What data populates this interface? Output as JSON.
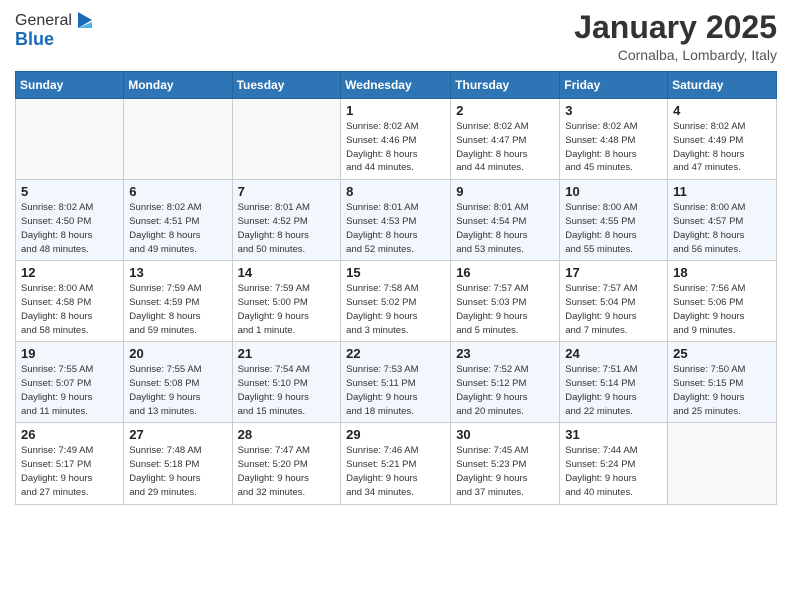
{
  "header": {
    "logo_general": "General",
    "logo_blue": "Blue",
    "month_title": "January 2025",
    "location": "Cornalba, Lombardy, Italy"
  },
  "weekdays": [
    "Sunday",
    "Monday",
    "Tuesday",
    "Wednesday",
    "Thursday",
    "Friday",
    "Saturday"
  ],
  "weeks": [
    [
      {
        "day": "",
        "info": ""
      },
      {
        "day": "",
        "info": ""
      },
      {
        "day": "",
        "info": ""
      },
      {
        "day": "1",
        "info": "Sunrise: 8:02 AM\nSunset: 4:46 PM\nDaylight: 8 hours\nand 44 minutes."
      },
      {
        "day": "2",
        "info": "Sunrise: 8:02 AM\nSunset: 4:47 PM\nDaylight: 8 hours\nand 44 minutes."
      },
      {
        "day": "3",
        "info": "Sunrise: 8:02 AM\nSunset: 4:48 PM\nDaylight: 8 hours\nand 45 minutes."
      },
      {
        "day": "4",
        "info": "Sunrise: 8:02 AM\nSunset: 4:49 PM\nDaylight: 8 hours\nand 47 minutes."
      }
    ],
    [
      {
        "day": "5",
        "info": "Sunrise: 8:02 AM\nSunset: 4:50 PM\nDaylight: 8 hours\nand 48 minutes."
      },
      {
        "day": "6",
        "info": "Sunrise: 8:02 AM\nSunset: 4:51 PM\nDaylight: 8 hours\nand 49 minutes."
      },
      {
        "day": "7",
        "info": "Sunrise: 8:01 AM\nSunset: 4:52 PM\nDaylight: 8 hours\nand 50 minutes."
      },
      {
        "day": "8",
        "info": "Sunrise: 8:01 AM\nSunset: 4:53 PM\nDaylight: 8 hours\nand 52 minutes."
      },
      {
        "day": "9",
        "info": "Sunrise: 8:01 AM\nSunset: 4:54 PM\nDaylight: 8 hours\nand 53 minutes."
      },
      {
        "day": "10",
        "info": "Sunrise: 8:00 AM\nSunset: 4:55 PM\nDaylight: 8 hours\nand 55 minutes."
      },
      {
        "day": "11",
        "info": "Sunrise: 8:00 AM\nSunset: 4:57 PM\nDaylight: 8 hours\nand 56 minutes."
      }
    ],
    [
      {
        "day": "12",
        "info": "Sunrise: 8:00 AM\nSunset: 4:58 PM\nDaylight: 8 hours\nand 58 minutes."
      },
      {
        "day": "13",
        "info": "Sunrise: 7:59 AM\nSunset: 4:59 PM\nDaylight: 8 hours\nand 59 minutes."
      },
      {
        "day": "14",
        "info": "Sunrise: 7:59 AM\nSunset: 5:00 PM\nDaylight: 9 hours\nand 1 minute."
      },
      {
        "day": "15",
        "info": "Sunrise: 7:58 AM\nSunset: 5:02 PM\nDaylight: 9 hours\nand 3 minutes."
      },
      {
        "day": "16",
        "info": "Sunrise: 7:57 AM\nSunset: 5:03 PM\nDaylight: 9 hours\nand 5 minutes."
      },
      {
        "day": "17",
        "info": "Sunrise: 7:57 AM\nSunset: 5:04 PM\nDaylight: 9 hours\nand 7 minutes."
      },
      {
        "day": "18",
        "info": "Sunrise: 7:56 AM\nSunset: 5:06 PM\nDaylight: 9 hours\nand 9 minutes."
      }
    ],
    [
      {
        "day": "19",
        "info": "Sunrise: 7:55 AM\nSunset: 5:07 PM\nDaylight: 9 hours\nand 11 minutes."
      },
      {
        "day": "20",
        "info": "Sunrise: 7:55 AM\nSunset: 5:08 PM\nDaylight: 9 hours\nand 13 minutes."
      },
      {
        "day": "21",
        "info": "Sunrise: 7:54 AM\nSunset: 5:10 PM\nDaylight: 9 hours\nand 15 minutes."
      },
      {
        "day": "22",
        "info": "Sunrise: 7:53 AM\nSunset: 5:11 PM\nDaylight: 9 hours\nand 18 minutes."
      },
      {
        "day": "23",
        "info": "Sunrise: 7:52 AM\nSunset: 5:12 PM\nDaylight: 9 hours\nand 20 minutes."
      },
      {
        "day": "24",
        "info": "Sunrise: 7:51 AM\nSunset: 5:14 PM\nDaylight: 9 hours\nand 22 minutes."
      },
      {
        "day": "25",
        "info": "Sunrise: 7:50 AM\nSunset: 5:15 PM\nDaylight: 9 hours\nand 25 minutes."
      }
    ],
    [
      {
        "day": "26",
        "info": "Sunrise: 7:49 AM\nSunset: 5:17 PM\nDaylight: 9 hours\nand 27 minutes."
      },
      {
        "day": "27",
        "info": "Sunrise: 7:48 AM\nSunset: 5:18 PM\nDaylight: 9 hours\nand 29 minutes."
      },
      {
        "day": "28",
        "info": "Sunrise: 7:47 AM\nSunset: 5:20 PM\nDaylight: 9 hours\nand 32 minutes."
      },
      {
        "day": "29",
        "info": "Sunrise: 7:46 AM\nSunset: 5:21 PM\nDaylight: 9 hours\nand 34 minutes."
      },
      {
        "day": "30",
        "info": "Sunrise: 7:45 AM\nSunset: 5:23 PM\nDaylight: 9 hours\nand 37 minutes."
      },
      {
        "day": "31",
        "info": "Sunrise: 7:44 AM\nSunset: 5:24 PM\nDaylight: 9 hours\nand 40 minutes."
      },
      {
        "day": "",
        "info": ""
      }
    ]
  ]
}
